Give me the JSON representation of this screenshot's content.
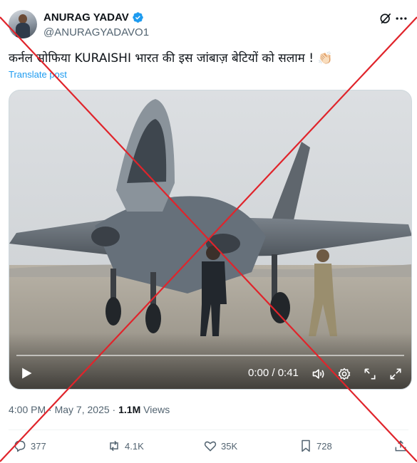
{
  "author": {
    "display_name": "ANURAG YADAV",
    "handle": "@ANURAGYADAVO1",
    "verified": true
  },
  "post": {
    "text": "कर्नल सोफिया KURAISHI भारत की इस जांबाज़ बेटियों को सलाम ! 👏🏻",
    "translate_label": "Translate post"
  },
  "video": {
    "time_display": "0:00 / 0:41",
    "progress": 0
  },
  "meta": {
    "time": "4:00 PM",
    "separator": "·",
    "date": "May 7, 2025",
    "views_count": "1.1M",
    "views_label": "Views"
  },
  "actions": {
    "replies": "377",
    "reposts": "4.1K",
    "likes": "35K",
    "bookmarks": "728"
  },
  "colors": {
    "accent": "#1d9bf0",
    "overlay_cross": "#e0242b",
    "text_primary": "#0f1419",
    "text_secondary": "#536471"
  }
}
